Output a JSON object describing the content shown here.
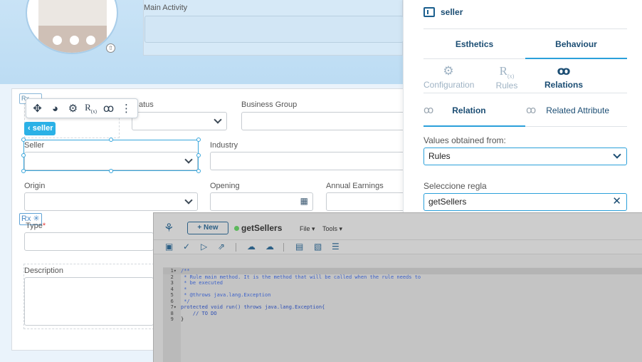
{
  "top": {
    "main_activity_label": "Main Activity"
  },
  "form": {
    "status_label": "Status",
    "status_label_visible": "atus",
    "business_group_label": "Business Group",
    "seller_label": "Seller",
    "industry_label": "Industry",
    "origin_label": "Origin",
    "opening_label": "Opening",
    "annual_earnings_label": "Annual Earnings",
    "type_label": "Type",
    "type_required_mark": "*",
    "description_label": "Description",
    "seller_chip_label": "seller",
    "rx_badge": "Rx",
    "rx_badge_symbol": "✳",
    "rx_mini_label": "Rx"
  },
  "toolbar": {
    "move_icon": "move-icon",
    "palette_icon": "palette-icon",
    "gear_icon": "gear-icon",
    "rules_icon": "rules-icon",
    "relations_icon": "relations-icon",
    "more_icon": "more-icon"
  },
  "panel": {
    "title": "seller",
    "tabs": [
      {
        "label": "Esthetics",
        "active": false
      },
      {
        "label": "Behaviour",
        "active": true
      }
    ],
    "subtabs": [
      {
        "label": "Configuration",
        "active": false
      },
      {
        "label": "Rules",
        "active": false
      },
      {
        "label": "Relations",
        "active": true
      }
    ],
    "relation_tabs": [
      {
        "label": "Relation",
        "active": true
      },
      {
        "label": "Related Attribute",
        "active": false
      }
    ],
    "values_label": "Values obtained from:",
    "values_selected": "Rules",
    "rule_label": "Seleccione regla",
    "rule_selected": "getSellers"
  },
  "editor": {
    "new_label": "+ New",
    "title": "getSellers",
    "menus": [
      "File ▾",
      "Tools ▾"
    ],
    "accent": "#2c5f85",
    "status_color": "#5cb85c",
    "code_lines": [
      {
        "n": "1",
        "marker": "▾",
        "text": "/**",
        "cls": "c-com"
      },
      {
        "n": "2",
        "marker": "",
        "text": " * Rule main method. It is the method that will be called when the rule needs to",
        "cls": "c-com"
      },
      {
        "n": "3",
        "marker": "",
        "text": " * be executed",
        "cls": "c-com"
      },
      {
        "n": "4",
        "marker": "",
        "text": " *",
        "cls": "c-com"
      },
      {
        "n": "5",
        "marker": "",
        "text": " * @throws java.lang.Exception",
        "cls": "c-com"
      },
      {
        "n": "6",
        "marker": "",
        "text": " */",
        "cls": "c-com"
      },
      {
        "n": "7",
        "marker": "▾",
        "text": "protected void run() throws java.lang.Exception{",
        "cls": "c-kw"
      },
      {
        "n": "8",
        "marker": "",
        "text": "    // TO DO",
        "cls": "c-kw"
      },
      {
        "n": "9",
        "marker": "",
        "text": "}",
        "cls": "c-norm"
      }
    ]
  },
  "colors": {
    "accent": "#2ba0da",
    "brand_dark": "#1b4d73",
    "chip": "#2bb1e6",
    "required": "#e23b3b"
  }
}
